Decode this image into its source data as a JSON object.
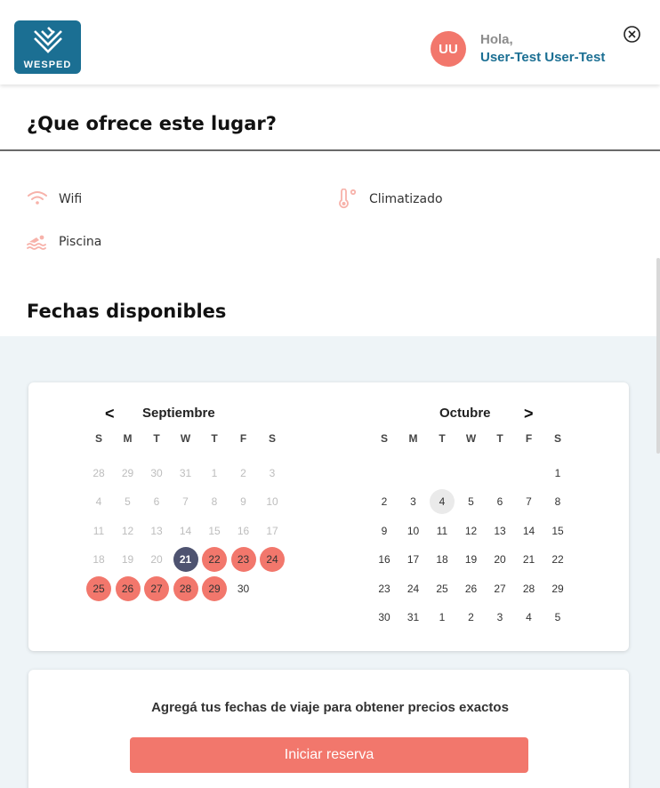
{
  "header": {
    "logo_text": "WESPED",
    "avatar_initials": "UU",
    "greeting": "Hola,",
    "user_name": "User-Test User-Test"
  },
  "features": {
    "title": "¿Que ofrece este lugar?",
    "items": [
      {
        "label": "Wifi",
        "icon": "wifi-icon"
      },
      {
        "label": "Climatizado",
        "icon": "thermometer-icon"
      },
      {
        "label": "Piscina",
        "icon": "swimming-icon"
      }
    ]
  },
  "dates": {
    "title": "Fechas disponibles",
    "prev_arrow": "<",
    "next_arrow": ">",
    "weekdays": [
      "S",
      "M",
      "T",
      "W",
      "T",
      "F",
      "S"
    ],
    "months": [
      {
        "name": "Septiembre",
        "weeks": [
          [
            "28",
            "29",
            "30",
            "31",
            "1",
            "2",
            "3"
          ],
          [
            "4",
            "5",
            "6",
            "7",
            "8",
            "9",
            "10"
          ],
          [
            "11",
            "12",
            "13",
            "14",
            "15",
            "16",
            "17"
          ],
          [
            "18",
            "19",
            "20",
            "21",
            "22",
            "23",
            "24"
          ],
          [
            "25",
            "26",
            "27",
            "28",
            "29",
            "30",
            ""
          ]
        ],
        "muted_days": [
          "28",
          "29",
          "30",
          "31",
          "1",
          "2",
          "3",
          "4",
          "5",
          "6",
          "7",
          "8",
          "9",
          "10",
          "11",
          "12",
          "13",
          "14",
          "15",
          "16",
          "17",
          "18",
          "19",
          "20"
        ],
        "today": "21",
        "selected_days": [
          "22",
          "23",
          "24",
          "25",
          "26",
          "27",
          "28",
          "29"
        ]
      },
      {
        "name": "Octubre",
        "weeks": [
          [
            "",
            "",
            "",
            "",
            "",
            "",
            "1"
          ],
          [
            "2",
            "3",
            "4",
            "5",
            "6",
            "7",
            "8"
          ],
          [
            "9",
            "10",
            "11",
            "12",
            "13",
            "14",
            "15"
          ],
          [
            "16",
            "17",
            "18",
            "19",
            "20",
            "21",
            "22"
          ],
          [
            "23",
            "24",
            "25",
            "26",
            "27",
            "28",
            "29"
          ],
          [
            "30",
            "31",
            "1",
            "2",
            "3",
            "4",
            "5"
          ]
        ],
        "hover_day": "4"
      }
    ]
  },
  "booking": {
    "prompt": "Agregá tus fechas de viaje para obtener precios exactos",
    "button_label": "Iniciar reserva"
  },
  "colors": {
    "brand_blue": "#1b6f93",
    "accent_coral": "#f2776c",
    "today_navy": "#4e5370",
    "section_bg": "#eef4f7"
  }
}
